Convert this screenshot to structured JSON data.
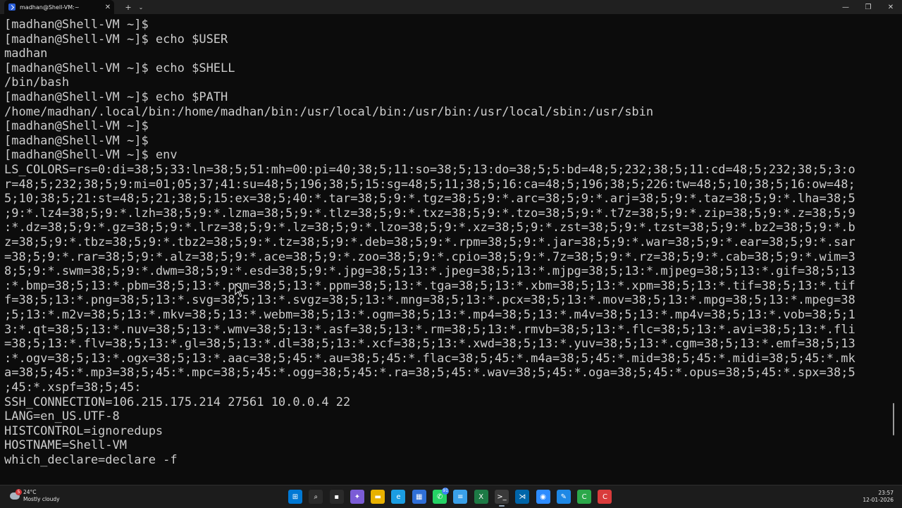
{
  "window": {
    "tab_title": "madhan@Shell-VM:~",
    "tab_close": "✕",
    "new_tab": "+",
    "dropdown": "⌄",
    "minimize": "—",
    "maximize": "❐",
    "close": "✕"
  },
  "terminal": {
    "lines": [
      "[madhan@Shell-VM ~]$",
      "[madhan@Shell-VM ~]$ echo $USER",
      "madhan",
      "[madhan@Shell-VM ~]$ echo $SHELL",
      "/bin/bash",
      "[madhan@Shell-VM ~]$ echo $PATH",
      "/home/madhan/.local/bin:/home/madhan/bin:/usr/local/bin:/usr/bin:/usr/local/sbin:/usr/sbin",
      "[madhan@Shell-VM ~]$",
      "[madhan@Shell-VM ~]$",
      "[madhan@Shell-VM ~]$ env",
      "LS_COLORS=rs=0:di=38;5;33:ln=38;5;51:mh=00:pi=40;38;5;11:so=38;5;13:do=38;5;5:bd=48;5;232;38;5;11:cd=48;5;232;38;5;3:o",
      "r=48;5;232;38;5;9:mi=01;05;37;41:su=48;5;196;38;5;15:sg=48;5;11;38;5;16:ca=48;5;196;38;5;226:tw=48;5;10;38;5;16:ow=48;",
      "5;10;38;5;21:st=48;5;21;38;5;15:ex=38;5;40:*.tar=38;5;9:*.tgz=38;5;9:*.arc=38;5;9:*.arj=38;5;9:*.taz=38;5;9:*.lha=38;5",
      ";9:*.lz4=38;5;9:*.lzh=38;5;9:*.lzma=38;5;9:*.tlz=38;5;9:*.txz=38;5;9:*.tzo=38;5;9:*.t7z=38;5;9:*.zip=38;5;9:*.z=38;5;9",
      ":*.dz=38;5;9:*.gz=38;5;9:*.lrz=38;5;9:*.lz=38;5;9:*.lzo=38;5;9:*.xz=38;5;9:*.zst=38;5;9:*.tzst=38;5;9:*.bz2=38;5;9:*.b",
      "z=38;5;9:*.tbz=38;5;9:*.tbz2=38;5;9:*.tz=38;5;9:*.deb=38;5;9:*.rpm=38;5;9:*.jar=38;5;9:*.war=38;5;9:*.ear=38;5;9:*.sar",
      "=38;5;9:*.rar=38;5;9:*.alz=38;5;9:*.ace=38;5;9:*.zoo=38;5;9:*.cpio=38;5;9:*.7z=38;5;9:*.rz=38;5;9:*.cab=38;5;9:*.wim=3",
      "8;5;9:*.swm=38;5;9:*.dwm=38;5;9:*.esd=38;5;9:*.jpg=38;5;13:*.jpeg=38;5;13:*.mjpg=38;5;13:*.mjpeg=38;5;13:*.gif=38;5;13",
      ":*.bmp=38;5;13:*.pbm=38;5;13:*.pgm=38;5;13:*.ppm=38;5;13:*.tga=38;5;13:*.xbm=38;5;13:*.xpm=38;5;13:*.tif=38;5;13:*.tif",
      "f=38;5;13:*.png=38;5;13:*.svg=38;5;13:*.svgz=38;5;13:*.mng=38;5;13:*.pcx=38;5;13:*.mov=38;5;13:*.mpg=38;5;13:*.mpeg=38",
      ";5;13:*.m2v=38;5;13:*.mkv=38;5;13:*.webm=38;5;13:*.ogm=38;5;13:*.mp4=38;5;13:*.m4v=38;5;13:*.mp4v=38;5;13:*.vob=38;5;1",
      "3:*.qt=38;5;13:*.nuv=38;5;13:*.wmv=38;5;13:*.asf=38;5;13:*.rm=38;5;13:*.rmvb=38;5;13:*.flc=38;5;13:*.avi=38;5;13:*.fli",
      "=38;5;13:*.flv=38;5;13:*.gl=38;5;13:*.dl=38;5;13:*.xcf=38;5;13:*.xwd=38;5;13:*.yuv=38;5;13:*.cgm=38;5;13:*.emf=38;5;13",
      ":*.ogv=38;5;13:*.ogx=38;5;13:*.aac=38;5;45:*.au=38;5;45:*.flac=38;5;45:*.m4a=38;5;45:*.mid=38;5;45:*.midi=38;5;45:*.mk",
      "a=38;5;45:*.mp3=38;5;45:*.mpc=38;5;45:*.ogg=38;5;45:*.ra=38;5;45:*.wav=38;5;45:*.oga=38;5;45:*.opus=38;5;45:*.spx=38;5",
      ";45:*.xspf=38;5;45:",
      "SSH_CONNECTION=106.215.175.214 27561 10.0.0.4 22",
      "LANG=en_US.UTF-8",
      "HISTCONTROL=ignoredups",
      "HOSTNAME=Shell-VM",
      "which_declare=declare -f"
    ],
    "text_color": "#cccccc",
    "background": "#0c0c0c"
  },
  "taskbar": {
    "weather": {
      "temperature": "24°C",
      "condition": "Mostly cloudy",
      "badge": "5"
    },
    "apps": [
      {
        "name": "start",
        "glyph": "⊞",
        "color": "#0078d4",
        "icon": "windows-icon"
      },
      {
        "name": "search",
        "glyph": "⌕",
        "color": "#2a2a2a",
        "icon": "search-icon"
      },
      {
        "name": "task-view",
        "glyph": "▪",
        "color": "#2a2a2a",
        "icon": "task-view-icon"
      },
      {
        "name": "copilot",
        "glyph": "✦",
        "color": "#7b5cd6",
        "icon": "copilot-icon"
      },
      {
        "name": "file-explorer",
        "glyph": "▬",
        "color": "#e8b100",
        "icon": "folder-icon"
      },
      {
        "name": "edge",
        "glyph": "e",
        "color": "#1b9de2",
        "icon": "edge-icon"
      },
      {
        "name": "store",
        "glyph": "▦",
        "color": "#2f6fd8",
        "icon": "store-icon"
      },
      {
        "name": "whatsapp",
        "glyph": "✆",
        "color": "#25d366",
        "icon": "whatsapp-icon",
        "badge": "91"
      },
      {
        "name": "notepad",
        "glyph": "≡",
        "color": "#3aa0e8",
        "icon": "notepad-icon"
      },
      {
        "name": "excel",
        "glyph": "X",
        "color": "#1d7a45",
        "icon": "excel-icon"
      },
      {
        "name": "terminal",
        "glyph": ">_",
        "color": "#3a3a3a",
        "icon": "terminal-icon",
        "active": true
      },
      {
        "name": "vscode",
        "glyph": "⋊",
        "color": "#0065a9",
        "icon": "vscode-icon"
      },
      {
        "name": "zoom",
        "glyph": "◉",
        "color": "#2d8cff",
        "icon": "zoom-icon"
      },
      {
        "name": "paint",
        "glyph": "✎",
        "color": "#1e88e5",
        "icon": "paint-icon"
      },
      {
        "name": "camtasia",
        "glyph": "C",
        "color": "#2ca84a",
        "icon": "camtasia-icon"
      },
      {
        "name": "recorder",
        "glyph": "C",
        "color": "#d93b3b",
        "icon": "recorder-icon"
      }
    ],
    "clock": {
      "time": "23:57",
      "date": "12-01-2026"
    }
  }
}
